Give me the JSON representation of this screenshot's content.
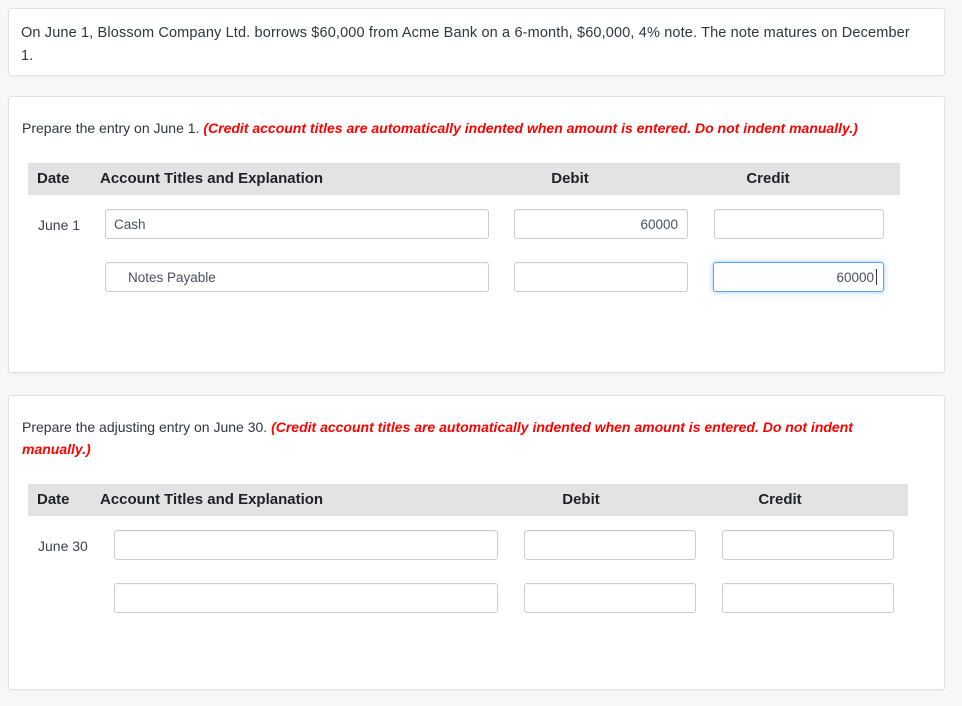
{
  "prompt": {
    "text": "On June 1, Blossom Company Ltd. borrows $60,000 from Acme Bank on a 6-month, $60,000, 4% note. The note matures on December 1."
  },
  "entry1": {
    "instruction_lead": "Prepare the entry on June 1. ",
    "instruction_warning": "(Credit account titles are automatically indented when amount is entered. Do not indent manually.)",
    "headers": {
      "date": "Date",
      "account_titles": "Account Titles and Explanation",
      "debit": "Debit",
      "credit": "Credit"
    },
    "date_label": "June 1",
    "rows": [
      {
        "account": "Cash",
        "debit": "60000",
        "credit": "",
        "indented": false,
        "focused_field": ""
      },
      {
        "account": "Notes Payable",
        "debit": "",
        "credit": "60000",
        "indented": true,
        "focused_field": "credit"
      }
    ]
  },
  "entry2": {
    "instruction_lead": "Prepare the adjusting entry on June 30. ",
    "instruction_warning": "(Credit account titles are automatically indented when amount is entered. Do not indent manually.)",
    "headers": {
      "date": "Date",
      "account_titles": "Account Titles and Explanation",
      "debit": "Debit",
      "credit": "Credit"
    },
    "date_label": "June 30",
    "rows": [
      {
        "account": "",
        "debit": "",
        "credit": "",
        "indented": false,
        "focused_field": ""
      },
      {
        "account": "",
        "debit": "",
        "credit": "",
        "indented": false,
        "focused_field": ""
      }
    ]
  },
  "colors": {
    "page_background": "#f7f7f7",
    "card_background": "#ffffff",
    "card_border": "#e2e2e2",
    "table_header_background": "#e3e3e3",
    "warning_text": "#ff0000",
    "body_text": "#2f3640",
    "input_border": "#cccccc",
    "input_focus_border": "#5ba7e5"
  }
}
